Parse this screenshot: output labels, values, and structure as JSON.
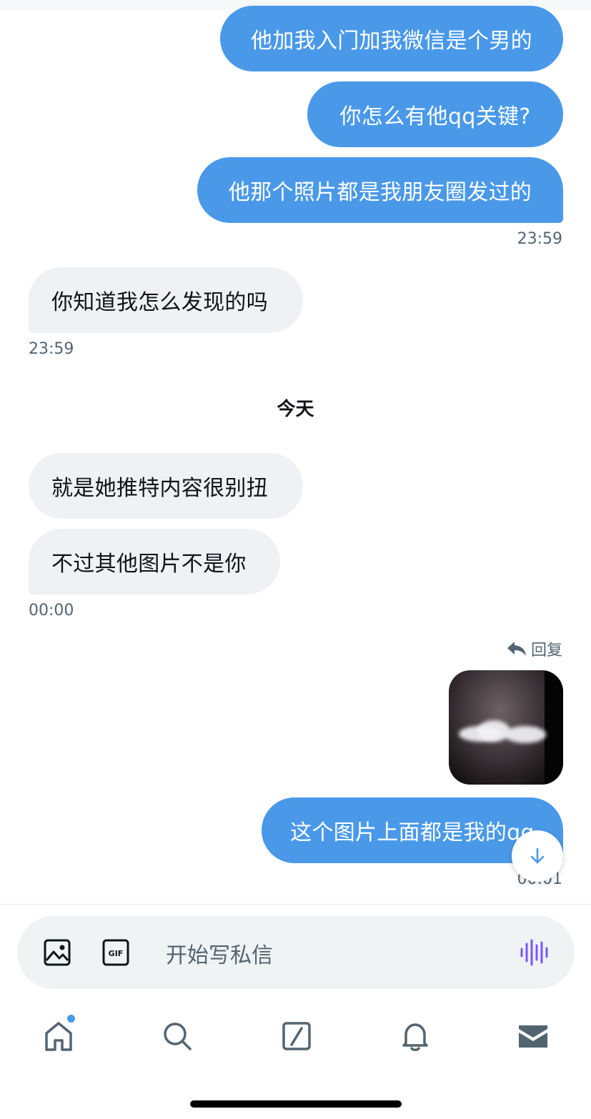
{
  "messages": {
    "out1": "他加我入门加我微信是个男的",
    "out2": "你怎么有他qq关键?",
    "out3": "他那个照片都是我朋友圈发过的",
    "time1": "23:59",
    "in1": "你知道我怎么发现的吗",
    "time2": "23:59",
    "day_header": "今天",
    "in2": "就是她推特内容很别扭",
    "in3": "不过其他图片不是你",
    "time3": "00:00",
    "reply_label": "回复",
    "out4": "这个图片上面都是我的qq",
    "time4": "00:01"
  },
  "composer": {
    "placeholder": "开始写私信"
  },
  "icons": {
    "image": "image-icon",
    "gif": "gif-icon",
    "voice": "voice-waveform-icon",
    "reply": "reply-arrow-icon",
    "scroll": "arrow-down-icon",
    "home": "home-icon",
    "search": "search-icon",
    "compose": "compose-icon",
    "notifications": "bell-icon",
    "messages": "mail-icon"
  },
  "colors": {
    "outgoing_bubble": "#4a99e9",
    "incoming_bubble": "#eff1f4",
    "accent_purple": "#7856ff"
  }
}
